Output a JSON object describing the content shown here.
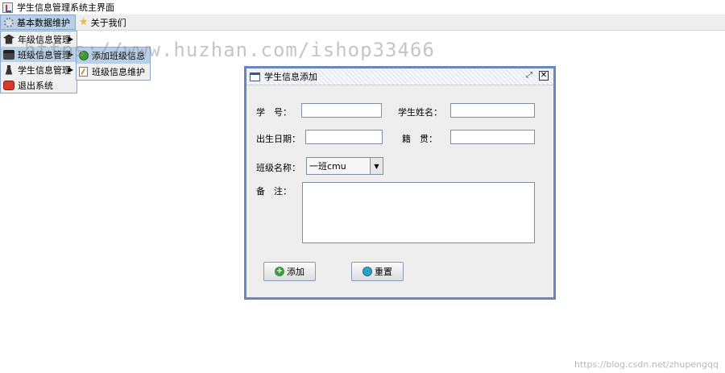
{
  "window": {
    "title": "学生信息管理系统主界面"
  },
  "menubar": {
    "items": [
      {
        "label": "基本数据维护",
        "icon": "gear-icon",
        "active": true
      },
      {
        "label": "关于我们",
        "icon": "star-icon",
        "active": false
      }
    ]
  },
  "dropdown": {
    "items": [
      {
        "label": "年级信息管理",
        "icon": "graduation-cap-icon"
      },
      {
        "label": "班级信息管理",
        "icon": "classroom-icon"
      },
      {
        "label": "学生信息管理",
        "icon": "student-icon"
      },
      {
        "label": "退出系统",
        "icon": "exit-icon"
      }
    ]
  },
  "submenu": {
    "items": [
      {
        "label": "添加班级信息",
        "icon": "add-icon"
      },
      {
        "label": "班级信息维护",
        "icon": "edit-icon"
      }
    ]
  },
  "watermark": "https://www.huzhan.com/ishop33466",
  "dialog": {
    "title": "学生信息添加",
    "labels": {
      "student_id": "学　号：",
      "student_name": "学生姓名：",
      "birth_date": "出生日期：",
      "native_place": "籍　贯：",
      "class_name": "班级名称：",
      "remarks": "备　注："
    },
    "fields": {
      "student_id": "",
      "student_name": "",
      "birth_date": "",
      "native_place": "",
      "class_selected": "一班cmu",
      "remarks": ""
    },
    "buttons": {
      "add": "添加",
      "reset": "重置"
    }
  },
  "footer_watermark": "https://blog.csdn.net/zhupengqq"
}
